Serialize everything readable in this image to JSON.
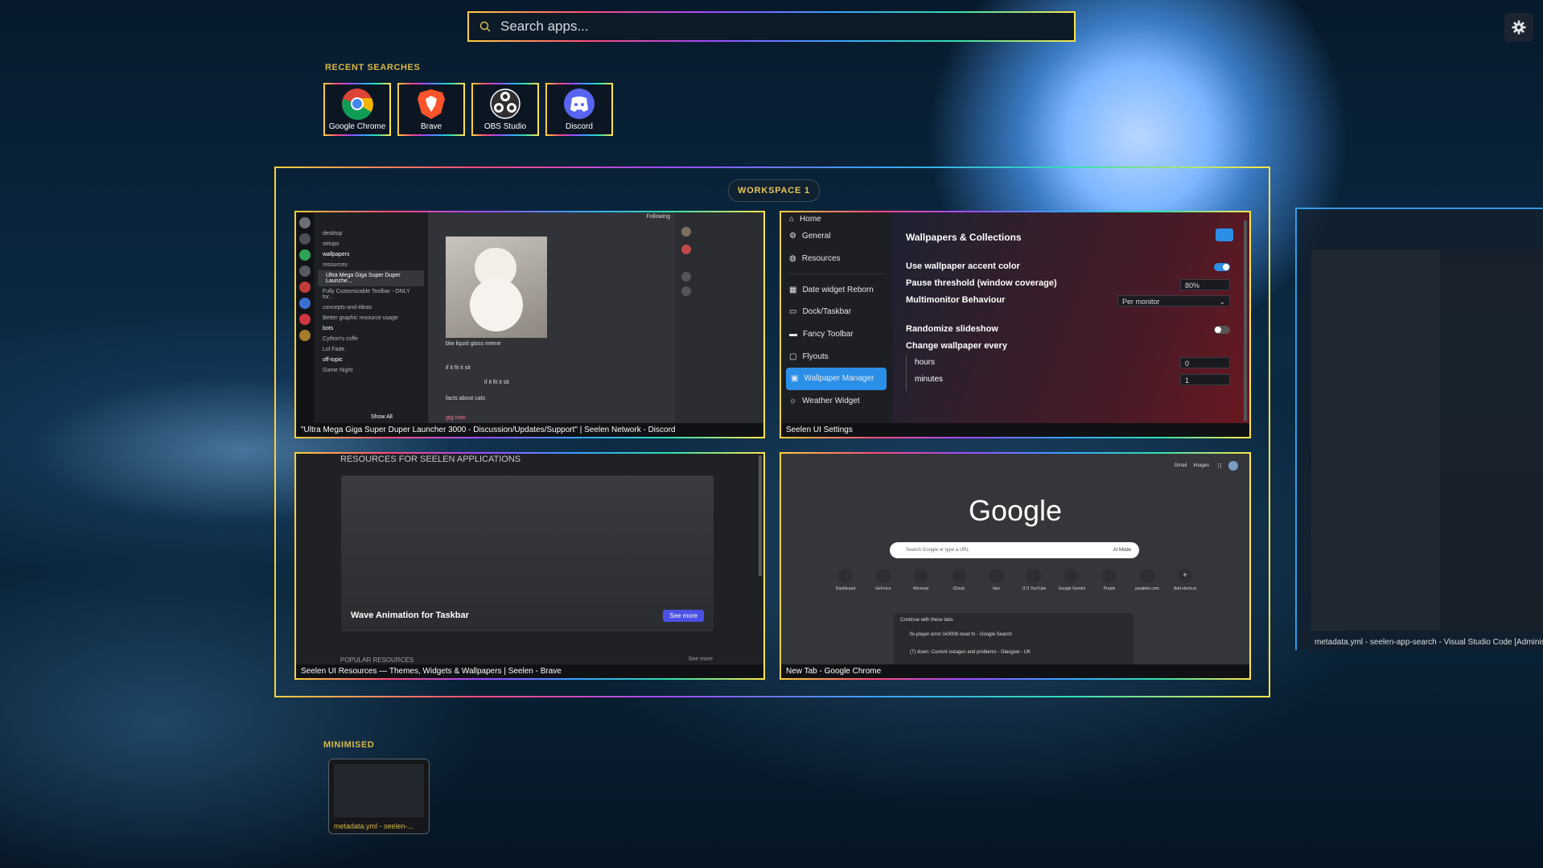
{
  "search": {
    "placeholder": "Search apps..."
  },
  "recent": {
    "label": "RECENT SEARCHES",
    "apps": [
      {
        "name": "Google Chrome",
        "icon": "chrome-icon"
      },
      {
        "name": "Brave",
        "icon": "brave-icon"
      },
      {
        "name": "OBS Studio",
        "icon": "obs-icon"
      },
      {
        "name": "Discord",
        "icon": "discord-icon"
      }
    ]
  },
  "workspace": {
    "title": "WORKSPACE 1"
  },
  "windows": {
    "discord": {
      "title": "\"Ultra Mega Giga Super Duper Launcher 3000 - Discussion/Updates/Support\" | Seelen Network - Discord",
      "channels": [
        "desktop",
        "setups",
        "wallpapers",
        "resources",
        "Ultra Mega Giga Super Duper Launche...",
        "Fully Customizable Toolbar - ONLY for...",
        "concepts-and-ideas",
        "Better graphic resource usage",
        "bots",
        "Cython's coffe",
        "Lol Fade",
        "off-topic",
        "Game Night"
      ],
      "show_all": "Show All",
      "following": "Following",
      "meme_caption": "blw liquid glass meme",
      "msg1": "if it fit it sit",
      "msg2": "if it fit it sit",
      "msg3": "facts about cats",
      "msg4": "gtg now"
    },
    "settings": {
      "title": "Seelen UI Settings",
      "nav": [
        "Home",
        "General",
        "Resources",
        "Date widget Reborn",
        "Dock/Taskbar",
        "Fancy Toolbar",
        "Flyouts",
        "Wallpaper Manager",
        "Weather Widget"
      ],
      "heading": "Wallpapers & Collections",
      "accent_label": "Use wallpaper accent color",
      "pause_label": "Pause threshold (window coverage)",
      "pause_value": "80%",
      "multimonitor_label": "Multimonitor Behaviour",
      "multimonitor_value": "Per monitor",
      "randomize_label": "Randomize slideshow",
      "change_label": "Change wallpaper every",
      "hours_label": "hours",
      "hours_value": "0",
      "minutes_label": "minutes",
      "minutes_value": "1",
      "accent_on": true,
      "randomize_on": false
    },
    "brave": {
      "title": "Seelen UI Resources — Themes, Widgets & Wallpapers | Seelen - Brave",
      "header": "RESOURCES FOR SEELEN APPLICATIONS",
      "card_title": "Wave Animation for Taskbar",
      "see_more": "See more",
      "popular": "POPULAR RESOURCES",
      "see_more_small": "See more"
    },
    "chrome": {
      "title": "New Tab - Google Chrome",
      "logo": "Google",
      "search_placeholder": "Search Google or type a URL",
      "ai_mode": "AI Mode",
      "top_links": [
        "Gmail",
        "Images"
      ],
      "shortcuts": [
        "Dashboard",
        "GeForce",
        "Weverse",
        "iCloud",
        "Vars",
        "(17) YouTube",
        "Google Gemini",
        "Purple",
        "parallels.com",
        "Add shortcut"
      ],
      "continue_label": "Continue with these tabs",
      "tab1": "fix-player error 0x0008 reset fx - Google Search",
      "tab2": "(7) down: Current outages and problems - Glasgow - UK"
    },
    "vscode": {
      "title": "metadata.yml - seelen-app-search - Visual Studio Code [Administrator]"
    }
  },
  "minimised": {
    "label": "MINIMISED",
    "items": [
      {
        "title": "metadata.yml - seelen-..."
      }
    ]
  },
  "colors": {
    "accent": "#2b8fe8",
    "gold": "#d7b84a"
  }
}
